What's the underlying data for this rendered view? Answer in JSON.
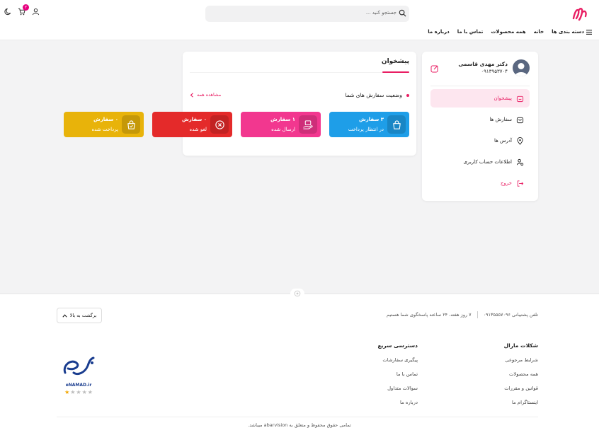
{
  "header": {
    "logo_text": "مارال",
    "search_placeholder": "جستجو کنید ...",
    "cart_count": "۲",
    "nav": {
      "categories": "دسته بندی ها",
      "home": "خانه",
      "all_products": "همه محصولات",
      "contact": "تماس با ما",
      "about": "درباره ما"
    }
  },
  "sidebar": {
    "user_name": "دکتر مهدی قاسمی",
    "user_phone": "۰۹۱۳۹۵۳۷۰۴",
    "items": [
      {
        "label": "پیشخوان",
        "icon": "home-icon",
        "active": true
      },
      {
        "label": "سفارش ها",
        "icon": "bag-icon"
      },
      {
        "label": "آدرس ها",
        "icon": "location-icon"
      },
      {
        "label": "اطلاعات حساب کاربری",
        "icon": "user-settings-icon"
      },
      {
        "label": "خروج",
        "icon": "logout-icon"
      }
    ]
  },
  "dashboard": {
    "title": "پیشخوان",
    "status_title": "وضعیت سفارش های شما",
    "view_all": "مشاهده همه",
    "tiles": [
      {
        "count": "۳ سفارش",
        "label": "در انتظار پرداخت",
        "color": "#1e9ee8",
        "icon": "bag-icon"
      },
      {
        "count": "۱ سفارش",
        "label": "ارسال شده",
        "color": "#f2378f",
        "icon": "delivery-icon"
      },
      {
        "count": "۰ سفارش",
        "label": "لغو شده",
        "color": "#e42a2a",
        "icon": "cancel-icon"
      },
      {
        "count": "۰ سفارش",
        "label": "پرداخت شده",
        "color": "#e8b30a",
        "icon": "paid-bag-icon"
      }
    ]
  },
  "footer": {
    "support_phone": "تلفن پشتیبانی ۰۹۱۳۵۵۵۷۰۹۶",
    "support_hours": "۷ روز هفته، ۲۴ ساعته پاسخگوی شما هستیم",
    "back_to_top": "برگشت به بالا",
    "col1_title": "شکلات مارال",
    "col1_links": [
      "شرایط مرجوعی",
      "همه محصولات",
      "قوانین و مقررات",
      "اینستاگرام ما"
    ],
    "col2_title": "دسترسی سریع",
    "col2_links": [
      "پیگیری سفارشات",
      "تماس با ما",
      "سوالات متداول",
      "درباره ما"
    ],
    "enamad_label": "eNAMAD.ir",
    "copyright": "تمامی حقوق محفوظ و متعلق به abarvision میباشد."
  },
  "colors": {
    "accent": "#e91e63",
    "blue": "#1e9ee8",
    "pink": "#f2378f",
    "red": "#e42a2a",
    "yellow": "#e8b30a"
  }
}
